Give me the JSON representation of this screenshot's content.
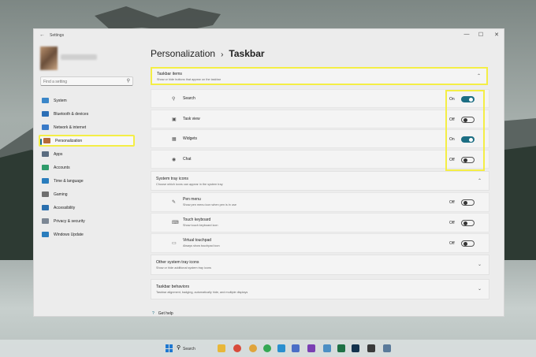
{
  "window": {
    "title": "Settings",
    "back": "←",
    "minimize": "—",
    "maximize": "☐",
    "close": "✕"
  },
  "sidebar": {
    "search_placeholder": "Find a setting",
    "search_icon": "⚲",
    "items": [
      {
        "label": "System",
        "icon": "system-icon",
        "color": "#3a86c8"
      },
      {
        "label": "Bluetooth & devices",
        "icon": "bluetooth-icon",
        "color": "#2c6fb6"
      },
      {
        "label": "Network & internet",
        "icon": "wifi-icon",
        "color": "#3a7bc8"
      },
      {
        "label": "Personalization",
        "icon": "brush-icon",
        "color": "#b56a3a"
      },
      {
        "label": "Apps",
        "icon": "apps-icon",
        "color": "#5a6c80"
      },
      {
        "label": "Accounts",
        "icon": "accounts-icon",
        "color": "#2f9b6a"
      },
      {
        "label": "Time & language",
        "icon": "clock-globe-icon",
        "color": "#2a7dbd"
      },
      {
        "label": "Gaming",
        "icon": "gaming-icon",
        "color": "#6e6e6e"
      },
      {
        "label": "Accessibility",
        "icon": "accessibility-icon",
        "color": "#2a6fae"
      },
      {
        "label": "Privacy & security",
        "icon": "shield-icon",
        "color": "#7c8794"
      },
      {
        "label": "Windows Update",
        "icon": "update-icon",
        "color": "#2a7dbd"
      }
    ],
    "active": "Personalization"
  },
  "breadcrumb": {
    "parent": "Personalization",
    "separator": "›",
    "current": "Taskbar"
  },
  "taskbar_items": {
    "title": "Taskbar items",
    "subtitle": "Show or hide buttons that appear on the taskbar",
    "chevron": "⌃",
    "rows": [
      {
        "label": "Search",
        "icon": "⚲",
        "state": "On"
      },
      {
        "label": "Task view",
        "icon": "▣",
        "state": "Off"
      },
      {
        "label": "Widgets",
        "icon": "▦",
        "state": "On"
      },
      {
        "label": "Chat",
        "icon": "◉",
        "state": "Off"
      }
    ]
  },
  "system_tray": {
    "title": "System tray icons",
    "subtitle": "Choose which icons can appear in the system tray",
    "chevron": "⌃",
    "rows": [
      {
        "label": "Pen menu",
        "sub": "Show pen menu icon when pen is in use",
        "icon": "✎",
        "state": "Off"
      },
      {
        "label": "Touch keyboard",
        "sub": "Show touch keyboard icon",
        "icon": "⌨",
        "state": "Off"
      },
      {
        "label": "Virtual touchpad",
        "sub": "Always show touchpad icon",
        "icon": "▭",
        "state": "Off"
      }
    ]
  },
  "other_tray": {
    "title": "Other system tray icons",
    "subtitle": "Show or hide additional system tray icons",
    "chevron": "⌄"
  },
  "behaviors": {
    "title": "Taskbar behaviors",
    "subtitle": "Taskbar alignment, badging, automatically hide, and multiple displays",
    "chevron": "⌄"
  },
  "help": {
    "label": "Get help",
    "icon": "?"
  },
  "os_taskbar": {
    "search_label": "Search",
    "apps": [
      {
        "name": "windows-start-icon",
        "color": "#1f78d1"
      },
      {
        "name": "file-explorer-icon",
        "color": "#e8b739"
      },
      {
        "name": "chrome-icon",
        "color": "#d84a3a"
      },
      {
        "name": "chrome-icon-2",
        "color": "#e0a43a"
      },
      {
        "name": "chrome-icon-3",
        "color": "#34a853"
      },
      {
        "name": "edge-icon",
        "color": "#2a8fcf"
      },
      {
        "name": "photos-icon",
        "color": "#4b6ec6"
      },
      {
        "name": "onenote-icon",
        "color": "#7a3fb2"
      },
      {
        "name": "notepad-icon",
        "color": "#4c8fc4"
      },
      {
        "name": "excel-icon",
        "color": "#1e7145"
      },
      {
        "name": "photoshop-icon",
        "color": "#13324d"
      },
      {
        "name": "terminal-icon",
        "color": "#3a3a3a"
      },
      {
        "name": "settings-icon",
        "color": "#5a7a9a"
      }
    ]
  }
}
